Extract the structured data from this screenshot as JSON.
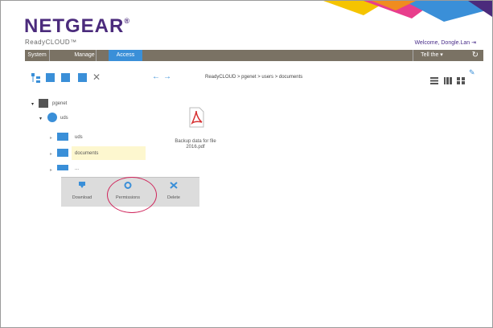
{
  "header": {
    "logo": "NETGEAR",
    "logo_mark": "®",
    "product": "ReadyCLOUD™",
    "welcome": "Welcome, Dongle.Lan ⇥"
  },
  "nav": {
    "tabs": [
      "System",
      "Manage",
      "Access"
    ],
    "active_tab": "Access",
    "right_label": "Tell the ▾",
    "accent_color": "#3a8fd8",
    "bar_color": "#7a7264"
  },
  "toolbar": {
    "breadcrumb": "ReadyCLOUD > pgenet > users > documents"
  },
  "tree": {
    "root": "pgenet",
    "child": "uds",
    "folders": [
      "uds",
      "documents",
      "..."
    ]
  },
  "file": {
    "name_line1": "Backup data for file",
    "name_line2": "2016.pdf"
  },
  "popup": {
    "download": "Download",
    "permissions": "Permissions",
    "delete": "Delete"
  }
}
